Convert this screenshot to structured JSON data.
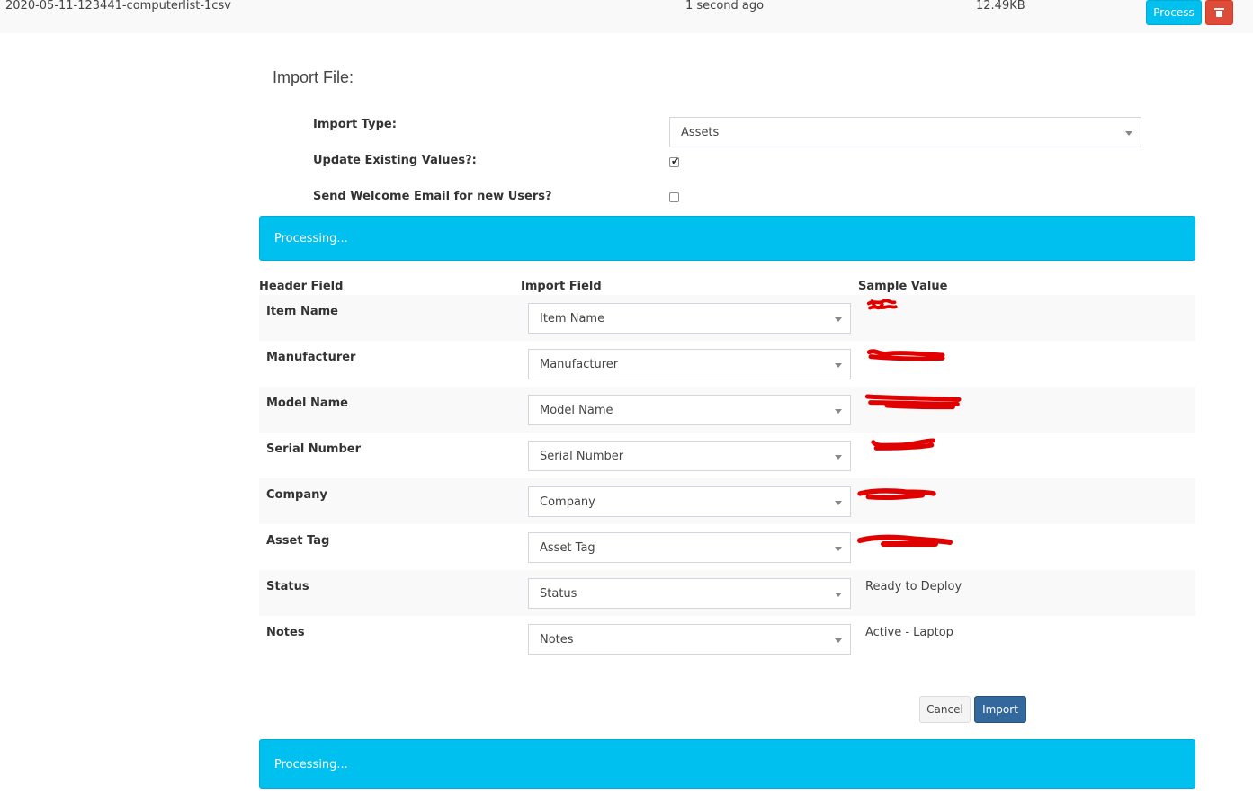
{
  "file_row": {
    "filename": "2020-05-11-123441-computerlist-1csv",
    "uploaded": "1 second ago",
    "size": "12.49KB",
    "process_label": "Process"
  },
  "import_form": {
    "title": "Import File:",
    "import_type_label": "Import Type:",
    "import_type_value": "Assets",
    "update_existing_label": "Update Existing Values?:",
    "update_existing_checked": true,
    "send_welcome_label": "Send Welcome Email for new Users?",
    "send_welcome_checked": false
  },
  "status_top": "Processing...",
  "mapping_table": {
    "headers": [
      "Header Field",
      "Import Field",
      "Sample Value"
    ],
    "rows": [
      {
        "header": "Item Name",
        "import_field": "Item Name",
        "sample": "",
        "redacted": true
      },
      {
        "header": "Manufacturer",
        "import_field": "Manufacturer",
        "sample": "",
        "redacted": true
      },
      {
        "header": "Model Name",
        "import_field": "Model Name",
        "sample": "",
        "redacted": true
      },
      {
        "header": "Serial Number",
        "import_field": "Serial Number",
        "sample": "",
        "redacted": true
      },
      {
        "header": "Company",
        "import_field": "Company",
        "sample": "",
        "redacted": true
      },
      {
        "header": "Asset Tag",
        "import_field": "Asset Tag",
        "sample": "",
        "redacted": true
      },
      {
        "header": "Status",
        "import_field": "Status",
        "sample": "Ready to Deploy",
        "redacted": false
      },
      {
        "header": "Notes",
        "import_field": "Notes",
        "sample": "Active - Laptop",
        "redacted": false
      }
    ]
  },
  "actions": {
    "cancel_label": "Cancel",
    "import_label": "Import"
  },
  "status_bottom": "Processing...",
  "colors": {
    "info": "#00c0ef",
    "danger": "#dd4b39",
    "primary": "#33689c",
    "redaction": "#e00000"
  }
}
